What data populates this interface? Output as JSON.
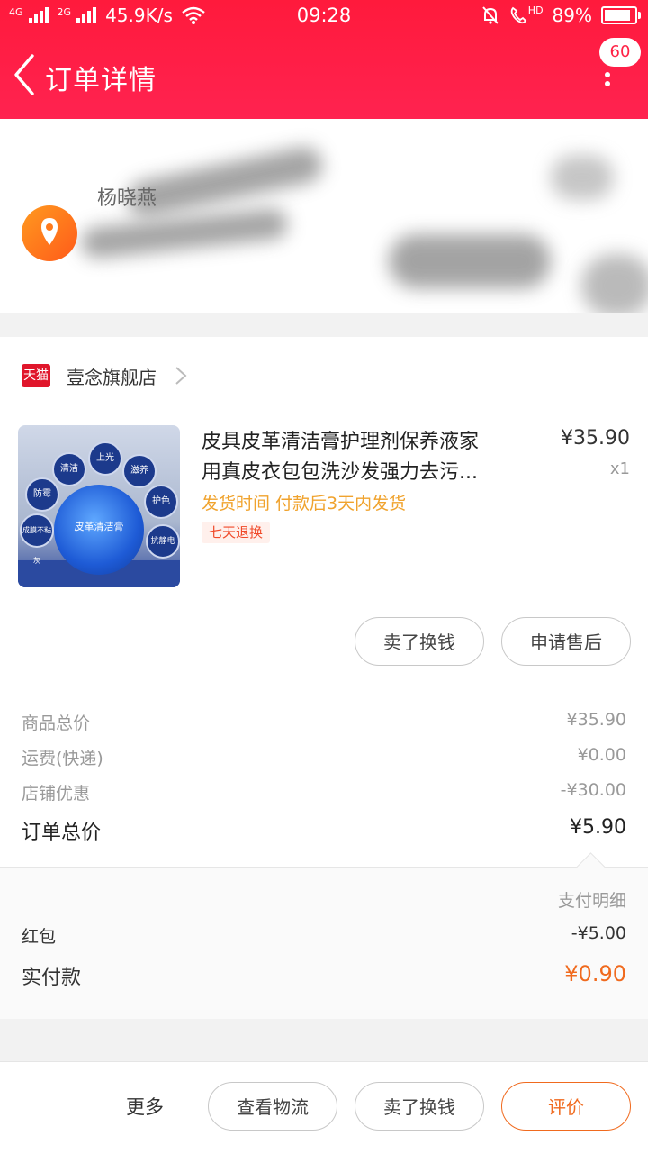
{
  "status_bar": {
    "network_1": "4G",
    "network_2": "2G",
    "speed": "45.9K/s",
    "time": "09:28",
    "hd_label": "HD",
    "battery": "89%",
    "battery_level": 0.89
  },
  "nav": {
    "title": "订单详情",
    "badge": "60"
  },
  "address": {
    "name": "杨晓燕"
  },
  "shop": {
    "tag": "天猫",
    "name": "壹念旗舰店"
  },
  "product": {
    "title_line1": "皮具皮革清洁膏护理剂保养液家",
    "title_line2": "用真皮衣包包洗沙发强力去污...",
    "price": "¥35.90",
    "qty": "x1",
    "ship_note": "发货时间 付款后3天内发货",
    "return_tag": "七天退换",
    "image_labels": [
      "清洁",
      "上光",
      "滋养",
      "防霉",
      "护色",
      "成膜不粘灰",
      "抗静电",
      "皮革清洁膏"
    ]
  },
  "actions": {
    "sell_label": "卖了换钱",
    "aftersale_label": "申请售后"
  },
  "summary": {
    "goods_total_label": "商品总价",
    "goods_total_value": "¥35.90",
    "shipping_label": "运费(快递)",
    "shipping_value": "¥0.00",
    "discount_label": "店铺优惠",
    "discount_value": "-¥30.00",
    "order_total_label": "订单总价",
    "order_total_value": "¥5.90"
  },
  "payment": {
    "detail_label": "支付明细",
    "redpacket_label": "红包",
    "redpacket_value": "-¥5.00",
    "paid_label": "实付款",
    "paid_value": "¥0.90"
  },
  "bottom": {
    "more": "更多",
    "logistics": "查看物流",
    "sell": "卖了换钱",
    "review": "评价"
  },
  "colors": {
    "brand_red": "#ff1f44",
    "accent_orange": "#f06a1e",
    "ship_orange": "#f0a32e"
  }
}
